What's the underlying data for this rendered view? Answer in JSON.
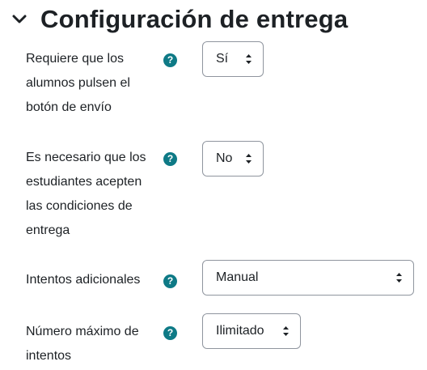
{
  "section": {
    "title": "Configuración de entrega",
    "expanded": true
  },
  "fields": [
    {
      "label_lines": [
        "Requiere que los",
        "alumnos pulsen el",
        "botón de envío"
      ],
      "help_icon": "question-circle-icon",
      "value": "Sí"
    },
    {
      "label_lines": [
        "Es necesario que los",
        "estudiantes acepten",
        "las condiciones de",
        "entrega"
      ],
      "help_icon": "question-circle-icon",
      "value": "No"
    },
    {
      "label_lines": [
        "Intentos adicionales"
      ],
      "help_icon": "question-circle-icon",
      "value": "Manual"
    },
    {
      "label_lines": [
        "Número máximo de",
        "intentos"
      ],
      "help_icon": "question-circle-icon",
      "value": "Ilimitado"
    }
  ],
  "colors": {
    "help_icon": "#0e7a86",
    "select_border": "#8f959e",
    "text": "#1d2125"
  }
}
